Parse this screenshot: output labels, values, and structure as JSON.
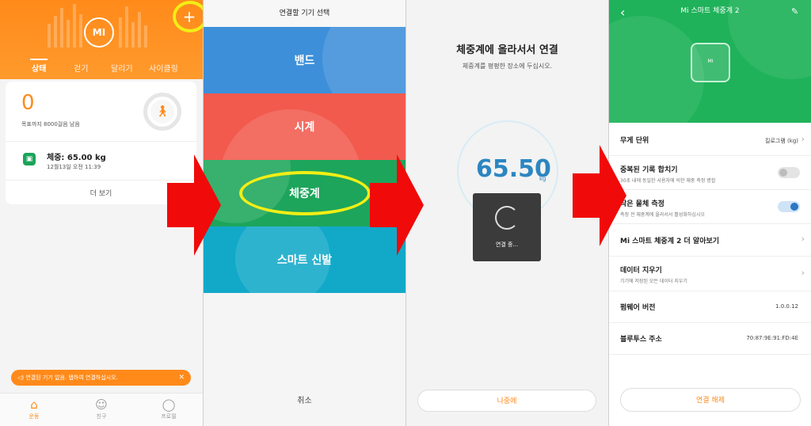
{
  "colors": {
    "orange": "#ff8a1a",
    "green": "#1fb25a",
    "arrow": "#f00a0a",
    "highlight": "#f2ee16",
    "blue": "#2c86c0"
  },
  "panel1": {
    "logo_text": "MI",
    "add_icon": "plus-icon",
    "tabs": [
      {
        "label": "상태",
        "active": true
      },
      {
        "label": "걷기"
      },
      {
        "label": "달리기"
      },
      {
        "label": "사이클링"
      }
    ],
    "steps": "0",
    "steps_note": "목표까지 8000걸음 남음",
    "walk_icon": "walking-person-icon",
    "weight_label": "체중: 65.00 kg",
    "weight_date": "12월13일 오전 11:39",
    "more_label": "더 보기",
    "warning": "연결된 기기 없음. 탭하여 연결하십시오.",
    "nav": [
      {
        "label": "운동",
        "icon": "home-icon",
        "active": true
      },
      {
        "label": "친구",
        "icon": "friends-icon"
      },
      {
        "label": "프로필",
        "icon": "profile-icon"
      }
    ]
  },
  "panel2": {
    "title": "연결할 기기 선택",
    "devices": [
      {
        "label": "밴드",
        "color": "#3d8fd9"
      },
      {
        "label": "시계",
        "color": "#f25a4e"
      },
      {
        "label": "체중계",
        "color": "#1da55b"
      },
      {
        "label": "스마트 신발",
        "color": "#12a9c9"
      }
    ],
    "cancel": "취소"
  },
  "panel3": {
    "title": "체중계에 올라서서 연결",
    "subtitle": "체중계를 평평한 장소에 두십시오.",
    "reading": "65.50",
    "unit": "kg",
    "connecting": "연결 중...",
    "later": "나중에"
  },
  "panel4": {
    "title": "Mi 스마트 체중계 2",
    "device_logo": "MI",
    "rows": [
      {
        "title": "무게 단위",
        "value": "킬로그램 (kg)"
      },
      {
        "title": "중복된 기록 합치기",
        "sub": "30초 내에 동일한 사용자에 의한 체중 측정 병합",
        "toggle": false
      },
      {
        "title": "작은 물체 측정",
        "sub": "측정 전 체중계에 올라서서 활성화하십시오",
        "toggle": true
      },
      {
        "title": "Mi 스마트 체중계 2 더 알아보기"
      },
      {
        "title": "데이터 지우기",
        "sub": "기기에 저장된 모든 데이터 지우기"
      },
      {
        "title": "펌웨어 버전",
        "value": "1.0.0.12"
      },
      {
        "title": "블루투스 주소",
        "value": "70:87:9E:91:FD:4E"
      }
    ],
    "disconnect": "연결 해제"
  }
}
